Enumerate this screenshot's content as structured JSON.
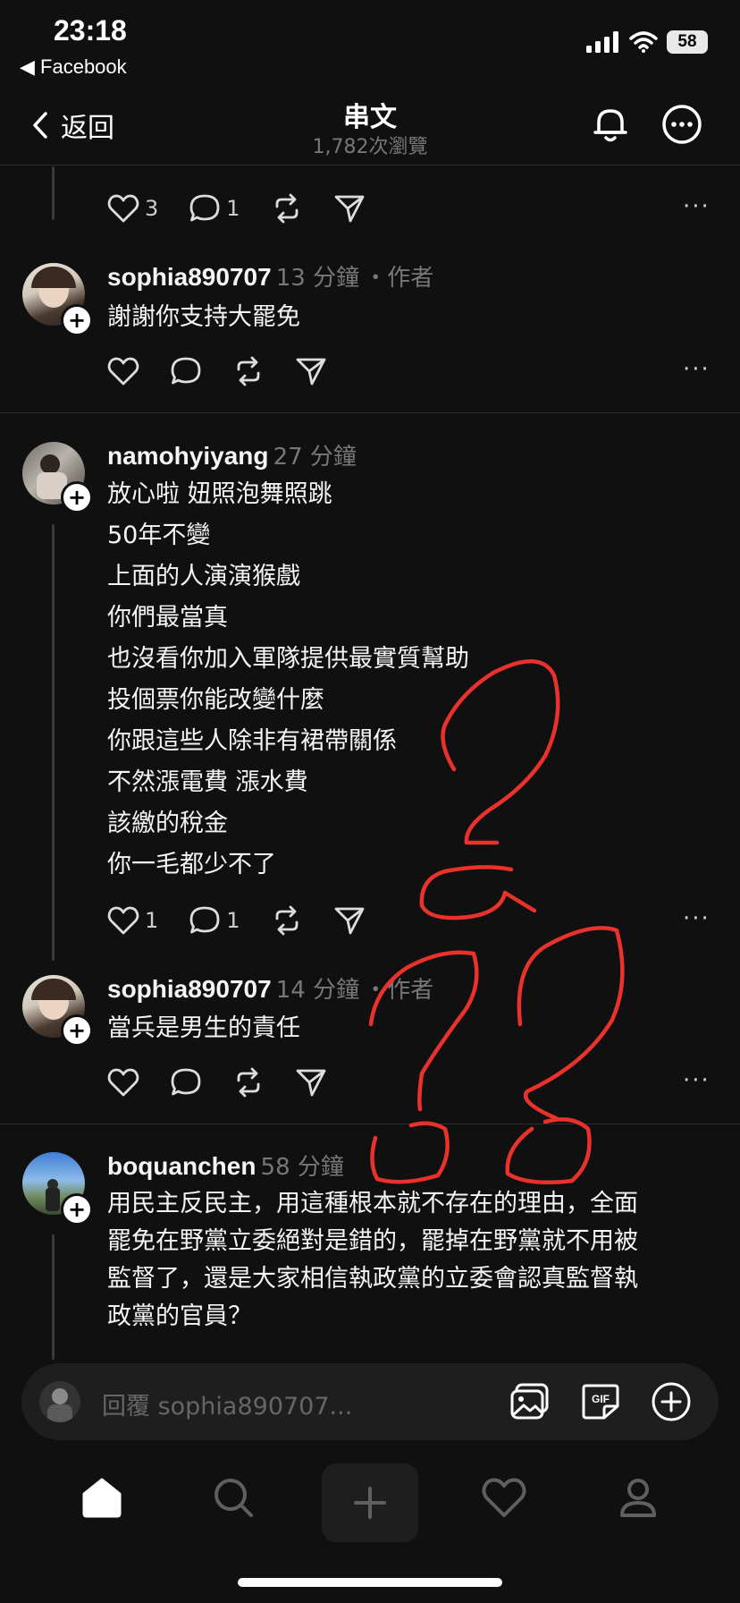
{
  "status_bar": {
    "time": "23:18",
    "back_app": "◀ Facebook",
    "battery": "58"
  },
  "header": {
    "back_label": "返回",
    "title": "串文",
    "views": "1,782次瀏覽"
  },
  "partial_post": {
    "likes": "3",
    "replies": "1"
  },
  "posts": [
    {
      "username": "sophia890707",
      "time": "13 分鐘",
      "author_tag": "・作者",
      "lines": [
        "謝謝你支持大罷免"
      ]
    },
    {
      "username": "namohyiyang",
      "time": "27 分鐘",
      "lines": [
        "放心啦 妞照泡舞照跳",
        "50年不變",
        "上面的人演演猴戲",
        "你們最當真",
        "也沒看你加入軍隊提供最實質幫助",
        "投個票你能改變什麼",
        "你跟這些人除非有裙帶關係",
        "不然漲電費 漲水費",
        "該繳的稅金",
        "你一毛都少不了"
      ],
      "likes": "1",
      "replies": "1"
    },
    {
      "username": "sophia890707",
      "time": "14 分鐘",
      "author_tag": "・作者",
      "lines": [
        "當兵是男生的責任"
      ]
    },
    {
      "username": "boquanchen",
      "time": "58 分鐘",
      "lines": [
        "用民主反民主，用這種根本就不存在的理由，全面",
        "罷免在野黨立委絕對是錯的，罷掉在野黨就不用被",
        "監督了，還是大家相信執政黨的立委會認真監督執",
        "政黨的官員？"
      ]
    }
  ],
  "reply_bar": {
    "placeholder": "回覆 sophia890707..."
  },
  "icons": {
    "gif_label": "GIF"
  },
  "colors": {
    "background": "#101010",
    "text": "#f3f5f7",
    "muted": "#777777",
    "annotation": "#e8322b"
  }
}
